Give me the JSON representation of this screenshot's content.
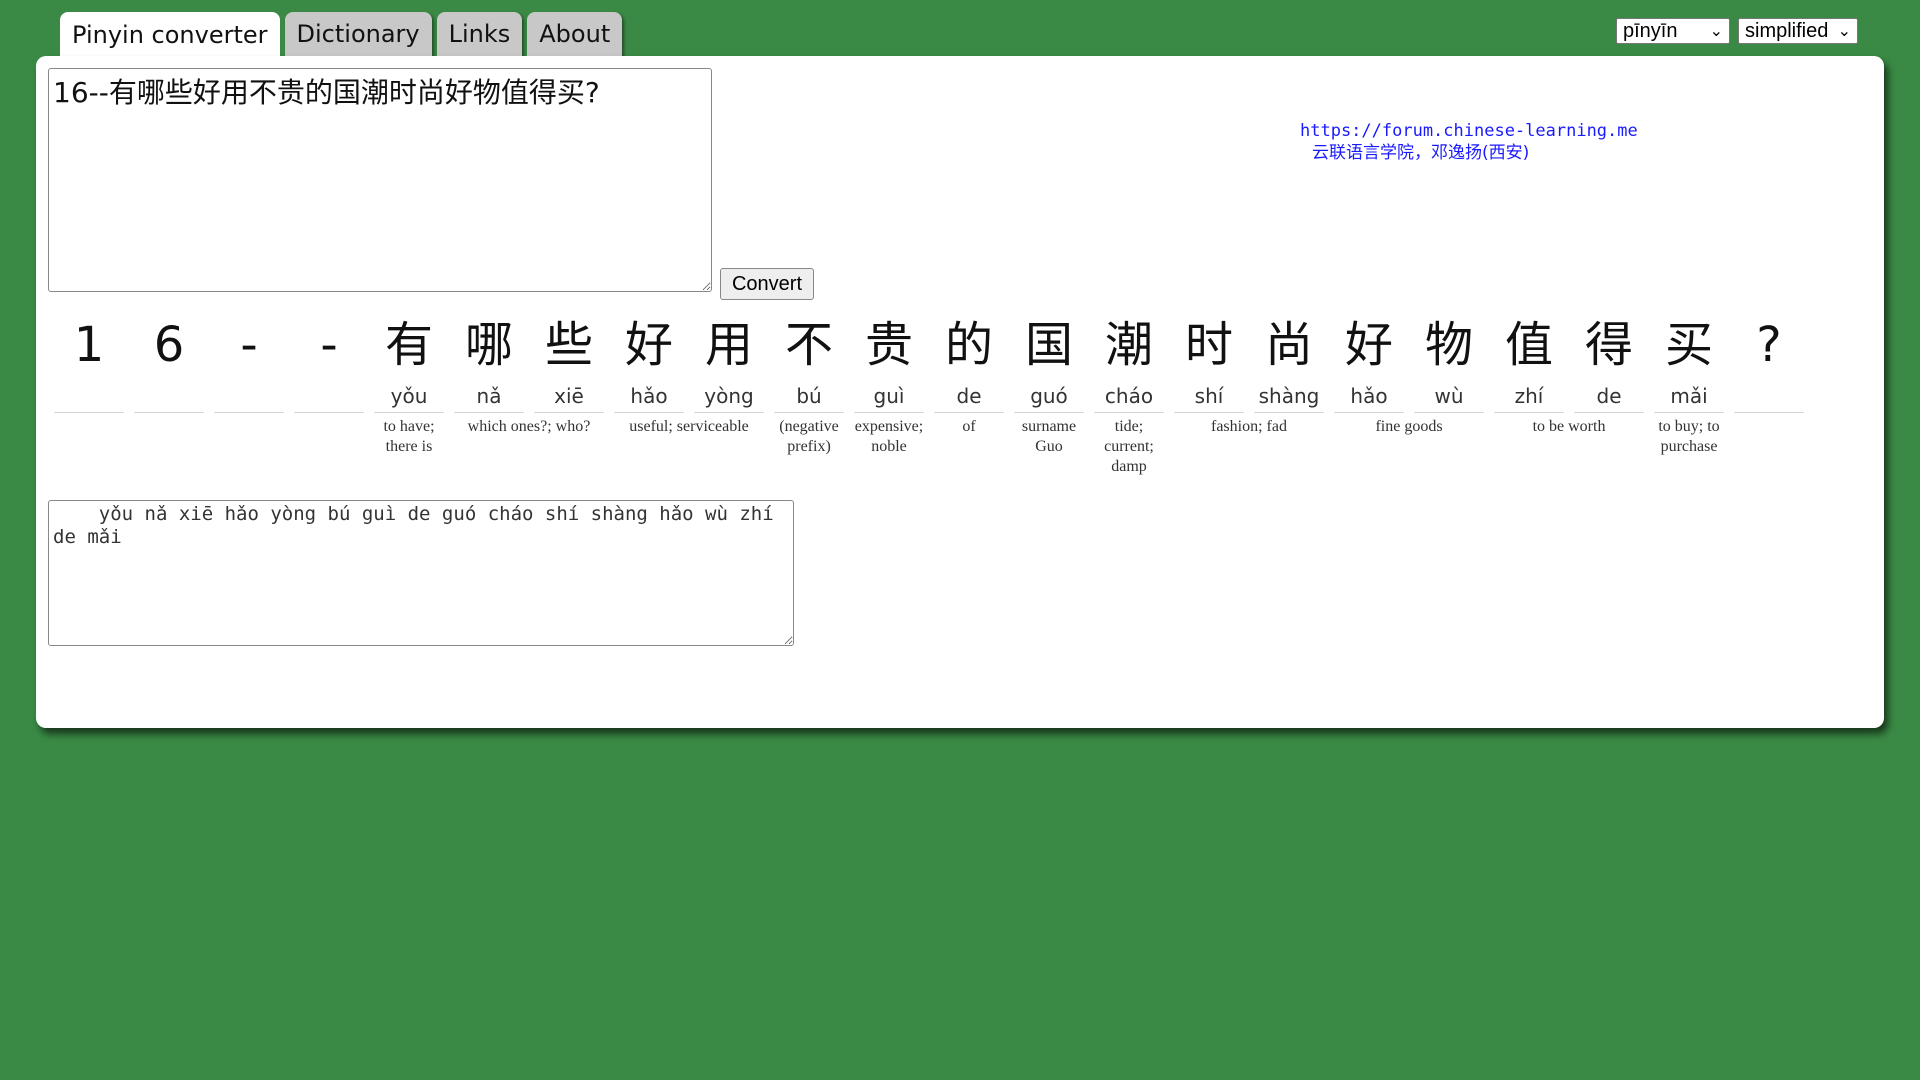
{
  "tabs": [
    {
      "label": "Pinyin converter",
      "active": true
    },
    {
      "label": "Dictionary",
      "active": false
    },
    {
      "label": "Links",
      "active": false
    },
    {
      "label": "About",
      "active": false
    }
  ],
  "selects": {
    "tone_style": "pīnyīn",
    "script": "simplified"
  },
  "input": {
    "value": "16--有哪些好用不贵的国潮时尚好物值得买?"
  },
  "convert_label": "Convert",
  "credit": {
    "url": "https://forum.chinese-learning.me",
    "line2": "云联语言学院，邓逸扬(西安)"
  },
  "groups": [
    {
      "chars": [
        {
          "hz": "1",
          "py": ""
        }
      ],
      "gloss": ""
    },
    {
      "chars": [
        {
          "hz": "6",
          "py": ""
        }
      ],
      "gloss": ""
    },
    {
      "chars": [
        {
          "hz": "-",
          "py": ""
        }
      ],
      "gloss": ""
    },
    {
      "chars": [
        {
          "hz": "-",
          "py": ""
        }
      ],
      "gloss": ""
    },
    {
      "chars": [
        {
          "hz": "有",
          "py": "yǒu"
        }
      ],
      "gloss": "to have; there is"
    },
    {
      "chars": [
        {
          "hz": "哪",
          "py": "nǎ"
        },
        {
          "hz": "些",
          "py": "xiē"
        }
      ],
      "gloss": "which ones?; who?"
    },
    {
      "chars": [
        {
          "hz": "好",
          "py": "hǎo"
        },
        {
          "hz": "用",
          "py": "yòng"
        }
      ],
      "gloss": "useful; serviceable"
    },
    {
      "chars": [
        {
          "hz": "不",
          "py": "bú"
        }
      ],
      "gloss": "(negative prefix)"
    },
    {
      "chars": [
        {
          "hz": "贵",
          "py": "guì"
        }
      ],
      "gloss": "expensive; noble"
    },
    {
      "chars": [
        {
          "hz": "的",
          "py": "de"
        }
      ],
      "gloss": "of"
    },
    {
      "chars": [
        {
          "hz": "国",
          "py": "guó"
        }
      ],
      "gloss": "surname Guo"
    },
    {
      "chars": [
        {
          "hz": "潮",
          "py": "cháo"
        }
      ],
      "gloss": "tide; current; damp"
    },
    {
      "chars": [
        {
          "hz": "时",
          "py": "shí"
        },
        {
          "hz": "尚",
          "py": "shàng"
        }
      ],
      "gloss": "fashion; fad"
    },
    {
      "chars": [
        {
          "hz": "好",
          "py": "hǎo"
        },
        {
          "hz": "物",
          "py": "wù"
        }
      ],
      "gloss": "fine goods"
    },
    {
      "chars": [
        {
          "hz": "值",
          "py": "zhí"
        },
        {
          "hz": "得",
          "py": "de"
        }
      ],
      "gloss": "to be worth"
    },
    {
      "chars": [
        {
          "hz": "买",
          "py": "mǎi"
        }
      ],
      "gloss": "to buy; to purchase"
    },
    {
      "chars": [
        {
          "hz": "?",
          "py": ""
        }
      ],
      "gloss": ""
    }
  ],
  "output": {
    "value": "    yǒu nǎ xiē hǎo yòng bú guì de guó cháo shí shàng hǎo wù zhí de mǎi"
  }
}
